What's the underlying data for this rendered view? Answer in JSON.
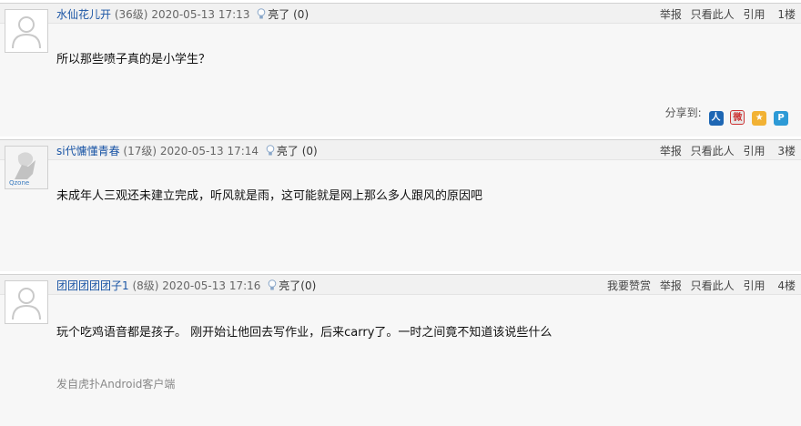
{
  "posts": [
    {
      "author": "水仙花儿开",
      "level": "(36级)",
      "time": "2020-05-13 17:13",
      "light_label": "亮了",
      "light_count": "(0)",
      "content": "所以那些喷子真的是小学生？",
      "actions": [
        "举报",
        "只看此人",
        "引用"
      ],
      "floor": "1楼",
      "share_label": "分享到:",
      "share_icons": [
        "renren-icon",
        "weibo-icon",
        "qzone-icon",
        "tencent-weibo-icon"
      ]
    },
    {
      "author": "si代慵懂青春",
      "level": "(17级)",
      "time": "2020-05-13 17:14",
      "light_label": "亮了",
      "light_count": "(0)",
      "content": "未成年人三观还未建立完成，听风就是雨，这可能就是网上那么多人跟风的原因吧",
      "actions": [
        "举报",
        "只看此人",
        "引用"
      ],
      "floor": "3楼",
      "avatar_text": "Qzone"
    },
    {
      "author": "团团团团团子1",
      "level": "(8级)",
      "time": "2020-05-13 17:16",
      "light_label": "亮了",
      "light_count": "(0)",
      "content": "玩个吃鸡语音都是孩子。 刚开始让他回去写作业，后来carry了。一时之间竟不知道该说些什么",
      "source": "发自虎扑Android客户端",
      "actions": [
        "我要赞赏",
        "举报",
        "只看此人",
        "引用"
      ],
      "floor": "4楼"
    }
  ]
}
